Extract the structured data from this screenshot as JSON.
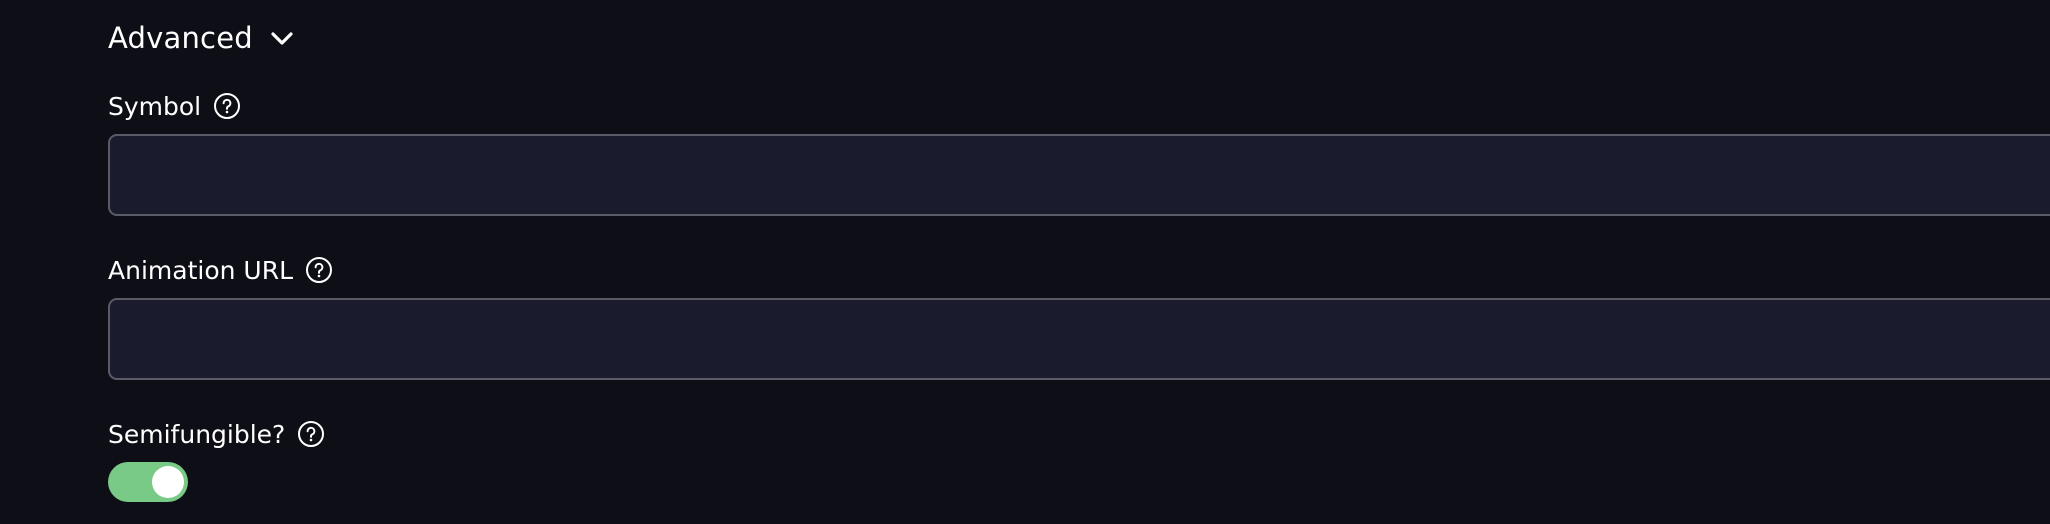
{
  "advanced": {
    "title": "Advanced",
    "expanded": true,
    "icon": "chevron-down-icon"
  },
  "fields": {
    "symbol": {
      "label": "Symbol",
      "value": "",
      "placeholder": "",
      "help_icon": "help-circle-icon"
    },
    "animation_url": {
      "label": "Animation URL",
      "value": "",
      "placeholder": "",
      "help_icon": "help-circle-icon"
    },
    "semifungible": {
      "label": "Semifungible?",
      "checked": true,
      "help_icon": "help-circle-icon"
    }
  },
  "colors": {
    "background": "#0e0e17",
    "input_background": "#1b1b2e",
    "input_border": "#5b5b67",
    "toggle_on": "#79c987",
    "text": "#ffffff"
  }
}
